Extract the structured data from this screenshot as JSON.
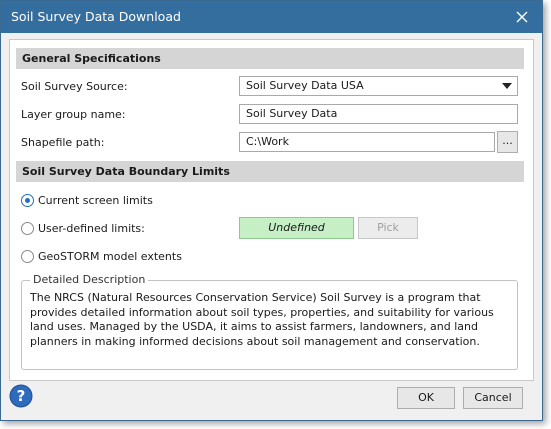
{
  "window": {
    "title": "Soil Survey Data Download"
  },
  "general": {
    "header": "General Specifications",
    "source_label": "Soil Survey Source:",
    "source_value": "Soil Survey Data USA",
    "layer_label": "Layer group name:",
    "layer_value": "Soil Survey Data",
    "path_label": "Shapefile path:",
    "path_value": "C:\\Work",
    "browse_label": "..."
  },
  "boundary": {
    "header": "Soil Survey Data Boundary Limits",
    "options": [
      {
        "label": "Current screen limits",
        "selected": true
      },
      {
        "label": "User-defined limits:",
        "selected": false
      },
      {
        "label": "GeoSTORM model extents",
        "selected": false
      }
    ],
    "undefined_text": "Undefined",
    "pick_label": "Pick"
  },
  "description": {
    "legend": "Detailed Description",
    "text": "The NRCS (Natural Resources Conservation Service) Soil Survey is a program that provides detailed information about soil types, properties, and suitability for various land uses. Managed by the USDA, it aims to assist farmers, landowners, and land planners in making informed decisions about soil management and conservation."
  },
  "footer": {
    "ok_label": "OK",
    "cancel_label": "Cancel"
  },
  "colors": {
    "titlebar": "#336e9f",
    "undefined_bg": "#c6efc6",
    "section_bg": "#d5d5d5"
  },
  "icons": {
    "close": "close-icon",
    "help": "help-icon",
    "dropdown": "chevron-down-icon"
  }
}
